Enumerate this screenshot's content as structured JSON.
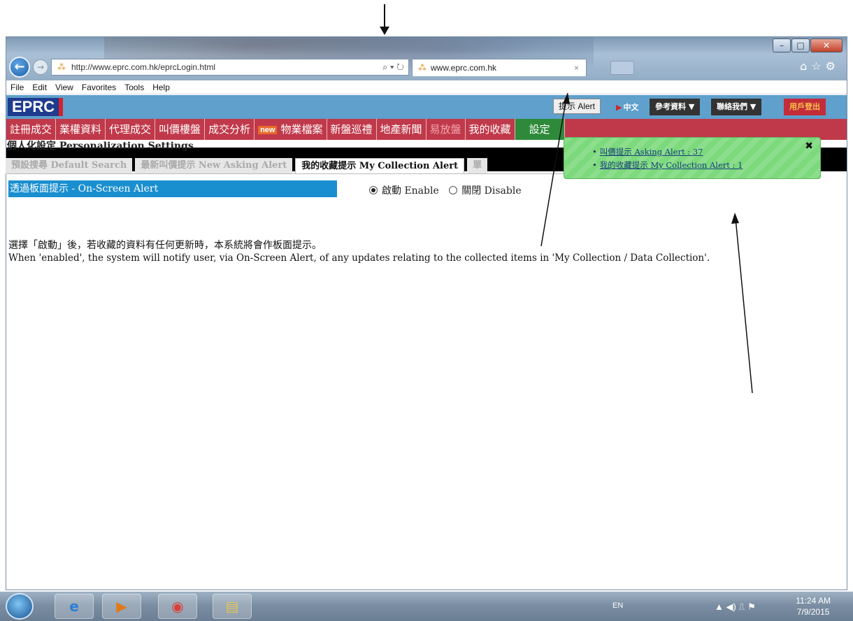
{
  "browser": {
    "url": "http://www.eprc.com.hk/eprcLogin.html",
    "tab_title": "www.eprc.com.hk",
    "menu": [
      "File",
      "Edit",
      "View",
      "Favorites",
      "Tools",
      "Help"
    ]
  },
  "header": {
    "logo": "EPRC",
    "alert_button": "提示 Alert",
    "language": "中文",
    "links": [
      "參考資料 ▼",
      "聯絡我們 ▼",
      "用戶登出"
    ]
  },
  "nav": {
    "items": [
      "註冊成交",
      "業權資料",
      "代理成交",
      "叫價樓盤",
      "成交分析",
      "物業檔案",
      "新盤巡禮",
      "地產新聞",
      "易放盤",
      "我的收藏",
      "設定"
    ],
    "new_badge": "new"
  },
  "page": {
    "title": "個人化設定 Personalization Settings",
    "tabs": [
      "預設搜尋 Default Search",
      "最新叫價提示 New Asking Alert",
      "我的收藏提示 My Collection Alert",
      "單"
    ],
    "active_tab_index": 2,
    "section_title": "透過板面提示 - On-Screen Alert",
    "enable_label": "啟動 Enable",
    "disable_label": "關閉 Disable",
    "enabled": true,
    "desc_cn": "選擇「啟動」後，若收藏的資料有任何更新時，本系統將會作板面提示。",
    "desc_en": "When 'enabled', the system will notify user, via On-Screen Alert, of any updates relating to the collected items in 'My Collection / Data Collection'."
  },
  "popup": {
    "items": [
      "叫價提示 Asking Alert : 37",
      "我的收藏提示 My Collection Alert : 1"
    ],
    "close": "✖"
  },
  "taskbar": {
    "lang": "EN",
    "time": "11:24 AM",
    "date": "7/9/2015"
  }
}
